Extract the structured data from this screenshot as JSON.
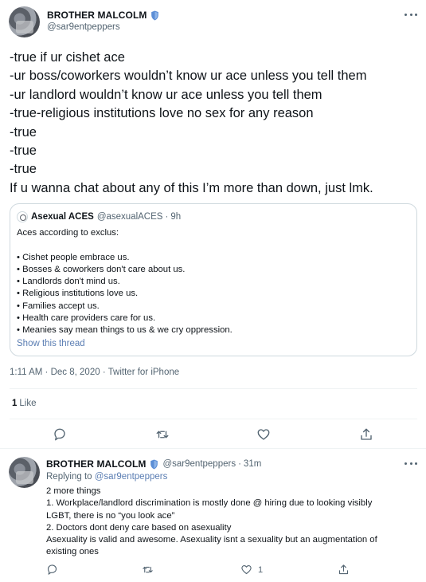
{
  "main_tweet": {
    "display_name": "BROTHER MALCOLM",
    "handle": "@sar9entpeppers",
    "lines": [
      "-true if ur cishet ace",
      "-ur boss/coworkers wouldn’t know ur ace unless you tell them",
      "-ur landlord wouldn’t know ur ace unless you tell them",
      "-true-religious institutions love no sex for any reason",
      "-true",
      "-true",
      "-true",
      "If u wanna chat about any of this I’m more than down, just lmk."
    ],
    "quote": {
      "display_name": "Asexual ACES",
      "handle": "@asexualACES",
      "dot": "·",
      "time": "9h",
      "intro": "Aces according to exclus:",
      "bullets": [
        "• Cishet people embrace us.",
        "• Bosses & coworkers don't care about us.",
        "• Landlords don't mind us.",
        "• Religious institutions love us.",
        "• Families accept us.",
        "• Health care providers care for us.",
        "•  Meanies say mean things to us & we cry oppression."
      ],
      "show_thread": "Show this thread"
    },
    "meta": {
      "time": "1:11 AM",
      "dot": "·",
      "date": "Dec 8, 2020",
      "source": "Twitter for iPhone"
    },
    "likes": {
      "count": "1",
      "label": "Like"
    },
    "actions": [
      "reply-icon",
      "retweet-icon",
      "like-icon",
      "share-icon"
    ]
  },
  "reply_tweet": {
    "display_name": "BROTHER MALCOLM",
    "handle": "@sar9entpeppers",
    "dot": "·",
    "time": "31m",
    "replying_prefix": "Replying to",
    "replying_handle": "@sar9entpeppers",
    "lines": [
      "2 more things",
      "1. Workplace/landlord discrimination is mostly done @ hiring due to looking visibly",
      "LGBT, there is no “you look ace”",
      "2. Doctors dont deny care based on asexuality",
      "Asexuality is valid and awesome. Asexuality isnt a sexuality but an augmentation of",
      "existing ones"
    ],
    "like_count": "1",
    "actions": [
      "reply-icon",
      "retweet-icon",
      "like-icon",
      "share-icon"
    ]
  },
  "colors": {
    "text": "#0f1419",
    "secondary": "#536471",
    "link": "#5b7eb3",
    "verified": "#5b8ed6",
    "border": "#cfd9de"
  }
}
